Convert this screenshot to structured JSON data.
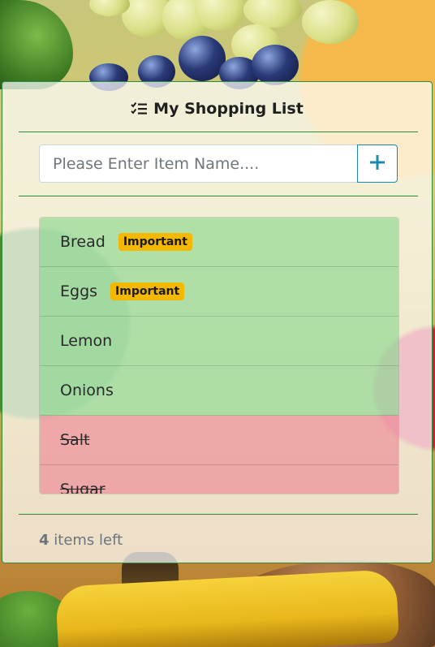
{
  "header": {
    "title": "My Shopping List",
    "icon": "checklist-icon"
  },
  "input": {
    "placeholder": "Please Enter Item Name....",
    "value": ""
  },
  "add_button": {
    "icon": "plus-icon",
    "color": "#1b8aa8"
  },
  "items": [
    {
      "name": "Bread",
      "badge": "Important",
      "done": false
    },
    {
      "name": "Eggs",
      "badge": "Important",
      "done": false
    },
    {
      "name": "Lemon",
      "badge": "",
      "done": false
    },
    {
      "name": "Onions",
      "badge": "",
      "done": false
    },
    {
      "name": "Salt",
      "badge": "",
      "done": true
    },
    {
      "name": "Sugar",
      "badge": "",
      "done": true
    }
  ],
  "footer": {
    "count": "4",
    "text": "items left"
  },
  "colors": {
    "active_item": "#86d78c",
    "done_item": "#ee8291",
    "badge": "#f5b800",
    "divider": "#2f8a3a"
  }
}
